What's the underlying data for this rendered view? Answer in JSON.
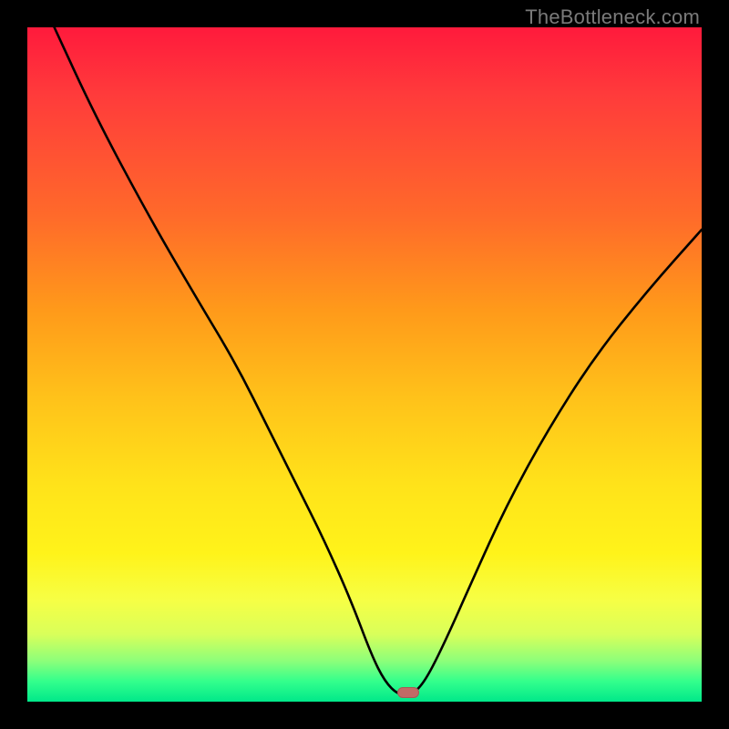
{
  "watermark": "TheBottleneck.com",
  "marker": {
    "x_pct": 56.5,
    "y_pct": 98.6
  },
  "chart_data": {
    "type": "line",
    "title": "",
    "xlabel": "",
    "ylabel": "",
    "xlim": [
      0,
      100
    ],
    "ylim": [
      0,
      100
    ],
    "grid": false,
    "legend": false,
    "annotations": [
      "TheBottleneck.com"
    ],
    "series": [
      {
        "name": "bottleneck-curve",
        "x": [
          4,
          10,
          18,
          25,
          31,
          36,
          40,
          44,
          48,
          51,
          53,
          55,
          57,
          59,
          62,
          66,
          71,
          77,
          84,
          92,
          100
        ],
        "y": [
          100,
          87,
          72,
          60,
          50,
          40,
          32,
          24,
          15,
          7,
          3,
          1,
          1,
          3,
          9,
          18,
          29,
          40,
          51,
          61,
          70
        ]
      }
    ],
    "background_gradient": {
      "direction": "vertical",
      "stops": [
        {
          "pos": 0,
          "color": "#ff1a3c"
        },
        {
          "pos": 28,
          "color": "#ff6a2a"
        },
        {
          "pos": 55,
          "color": "#ffc21a"
        },
        {
          "pos": 78,
          "color": "#fff31a"
        },
        {
          "pos": 94,
          "color": "#8cff7a"
        },
        {
          "pos": 100,
          "color": "#00e88a"
        }
      ]
    },
    "marker": {
      "x": 56.5,
      "y": 1.4,
      "shape": "pill",
      "color": "#c26a66"
    }
  }
}
